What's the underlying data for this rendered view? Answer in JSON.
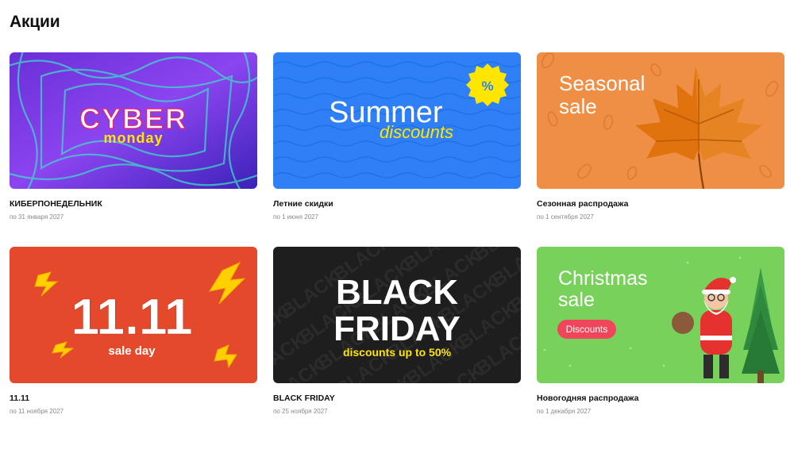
{
  "page": {
    "title": "Акции"
  },
  "promos": [
    {
      "title": "КИБЕРПОНЕДЕЛЬНИК",
      "date": "по 31 января 2027",
      "banner": {
        "line1": "CYBER",
        "line2": "monday",
        "bg": "#5b2fd1",
        "accent": "#ffe600"
      }
    },
    {
      "title": "Летние скидки",
      "date": "по 1 июня 2027",
      "banner": {
        "line1": "Summer",
        "line2": "discounts",
        "badge": "%",
        "bg": "#2f80f7",
        "accent": "#ffe600"
      }
    },
    {
      "title": "Сезонная распродажа",
      "date": "по 1 сентября 2027",
      "banner": {
        "line1": "Seasonal",
        "line2": "sale",
        "bg": "#ef8f45",
        "icon": "maple-leaf-icon"
      }
    },
    {
      "title": "11.11",
      "date": "по 11 ноября 2027",
      "banner": {
        "line1": "11.11",
        "line2": "sale day",
        "bg": "#e5492c",
        "icon": "lightning-bolt-icon",
        "accent": "#ffd000"
      }
    },
    {
      "title": "BLACK FRIDAY",
      "date": "по 25 ноября 2027",
      "banner": {
        "line1": "BLACK",
        "line2": "FRIDAY",
        "line3": "discounts up to 50%",
        "pattern": "BLACK",
        "bg": "#1e1e1e",
        "accent": "#ffe600"
      }
    },
    {
      "title": "Новогодняя распродажа",
      "date": "по 1 декабря 2027",
      "banner": {
        "line1": "Christmas",
        "line2": "sale",
        "pill": "Discounts",
        "bg": "#77d15b",
        "icon": "santa-with-tree-icon",
        "accent": "#f0455a"
      }
    }
  ]
}
